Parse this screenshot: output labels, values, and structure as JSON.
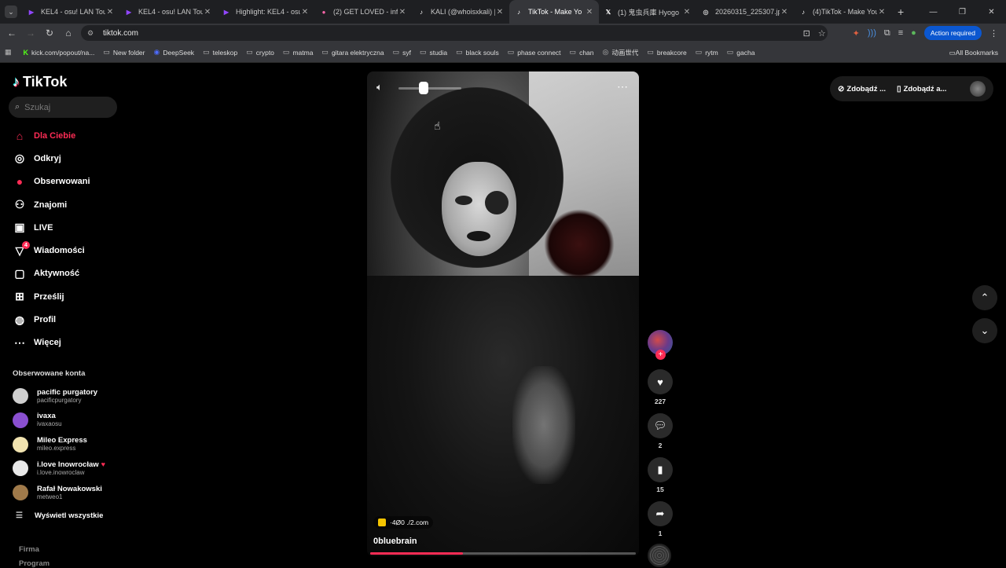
{
  "browser": {
    "tabs": [
      {
        "title": "KEL4 - osu! LAN Tour",
        "icon": "twitch",
        "color": "#9146ff"
      },
      {
        "title": "KEL4 - osu! LAN Tour",
        "icon": "twitch",
        "color": "#9146ff"
      },
      {
        "title": "Highlight: KEL4 - osu",
        "icon": "twitch",
        "color": "#9146ff"
      },
      {
        "title": "(2) GET LOVED - info",
        "icon": "osu",
        "color": "#ff66aa"
      },
      {
        "title": "KALI (@whoisxkali) | T",
        "icon": "tiktok",
        "color": "#ffffff"
      },
      {
        "title": "TikTok - Make Yo",
        "icon": "tiktok",
        "color": "#ffffff",
        "active": true
      },
      {
        "title": "(1) 鬼虫兵庫 Hyogo",
        "icon": "x",
        "color": "#ffffff"
      },
      {
        "title": "20260315_225307.jp",
        "icon": "globe",
        "color": "#cccccc"
      },
      {
        "title": "(4)TikTok - Make You",
        "icon": "tiktok",
        "color": "#ffffff"
      }
    ],
    "url": "tiktok.com",
    "action_required": "Action required",
    "bookmarks": [
      {
        "label": "kick.com/popout/na...",
        "icon": "kick"
      },
      {
        "label": "New folder",
        "icon": "folder"
      },
      {
        "label": "DeepSeek",
        "icon": "deepseek"
      },
      {
        "label": "teleskop",
        "icon": "folder"
      },
      {
        "label": "crypto",
        "icon": "folder"
      },
      {
        "label": "matma",
        "icon": "folder"
      },
      {
        "label": "gitara elektryczna",
        "icon": "folder"
      },
      {
        "label": "syf",
        "icon": "folder"
      },
      {
        "label": "studia",
        "icon": "folder"
      },
      {
        "label": "black souls",
        "icon": "folder"
      },
      {
        "label": "phase connect",
        "icon": "folder"
      },
      {
        "label": "chan",
        "icon": "folder"
      },
      {
        "label": "动画世代",
        "icon": "globe"
      },
      {
        "label": "breakcore",
        "icon": "folder"
      },
      {
        "label": "rytm",
        "icon": "folder"
      },
      {
        "label": "gacha",
        "icon": "folder"
      }
    ],
    "all_bookmarks": "All Bookmarks"
  },
  "tiktok": {
    "logo": "TikTok",
    "search_placeholder": "Szukaj",
    "nav": [
      {
        "label": "Dla Ciebie",
        "icon": "home-icon",
        "active": true
      },
      {
        "label": "Odkryj",
        "icon": "compass-icon"
      },
      {
        "label": "Obserwowani",
        "icon": "following-icon"
      },
      {
        "label": "Znajomi",
        "icon": "friends-icon"
      },
      {
        "label": "LIVE",
        "icon": "live-icon"
      },
      {
        "label": "Wiadomości",
        "icon": "messages-icon",
        "badge": "4"
      },
      {
        "label": "Aktywność",
        "icon": "activity-icon"
      },
      {
        "label": "Prześlij",
        "icon": "upload-icon"
      },
      {
        "label": "Profil",
        "icon": "profile-icon"
      },
      {
        "label": "Więcej",
        "icon": "more-icon"
      }
    ],
    "following_header": "Obserwowane konta",
    "accounts": [
      {
        "name": "pacific purgatory",
        "handle": "pacificpurgatory",
        "color": "#cfcfcf"
      },
      {
        "name": "ivaxa",
        "handle": "ivaxaosu",
        "color": "#8a4fd0"
      },
      {
        "name": "Mileo Express",
        "handle": "mileo.express",
        "color": "#f1e3b0"
      },
      {
        "name": "i.love Inowrocław",
        "handle": "i.love.inowroclaw",
        "color": "#e8e8e8",
        "heart": true
      },
      {
        "name": "Rafał Nowakowski",
        "handle": "metweo1",
        "color": "#a07a4a"
      }
    ],
    "see_all": "Wyświetl wszystkie",
    "footer": [
      "Firma",
      "Program"
    ],
    "top_right": {
      "btn1": "Zdobądź ...",
      "btn2": "Zdobądź a..."
    },
    "video": {
      "watermark": "·4Ø0 ./2.com",
      "author": "0bluebrain",
      "progress": 0.35,
      "volume": 0.4
    },
    "actions": {
      "likes": "227",
      "comments": "2",
      "saves": "15",
      "shares": "1"
    }
  }
}
